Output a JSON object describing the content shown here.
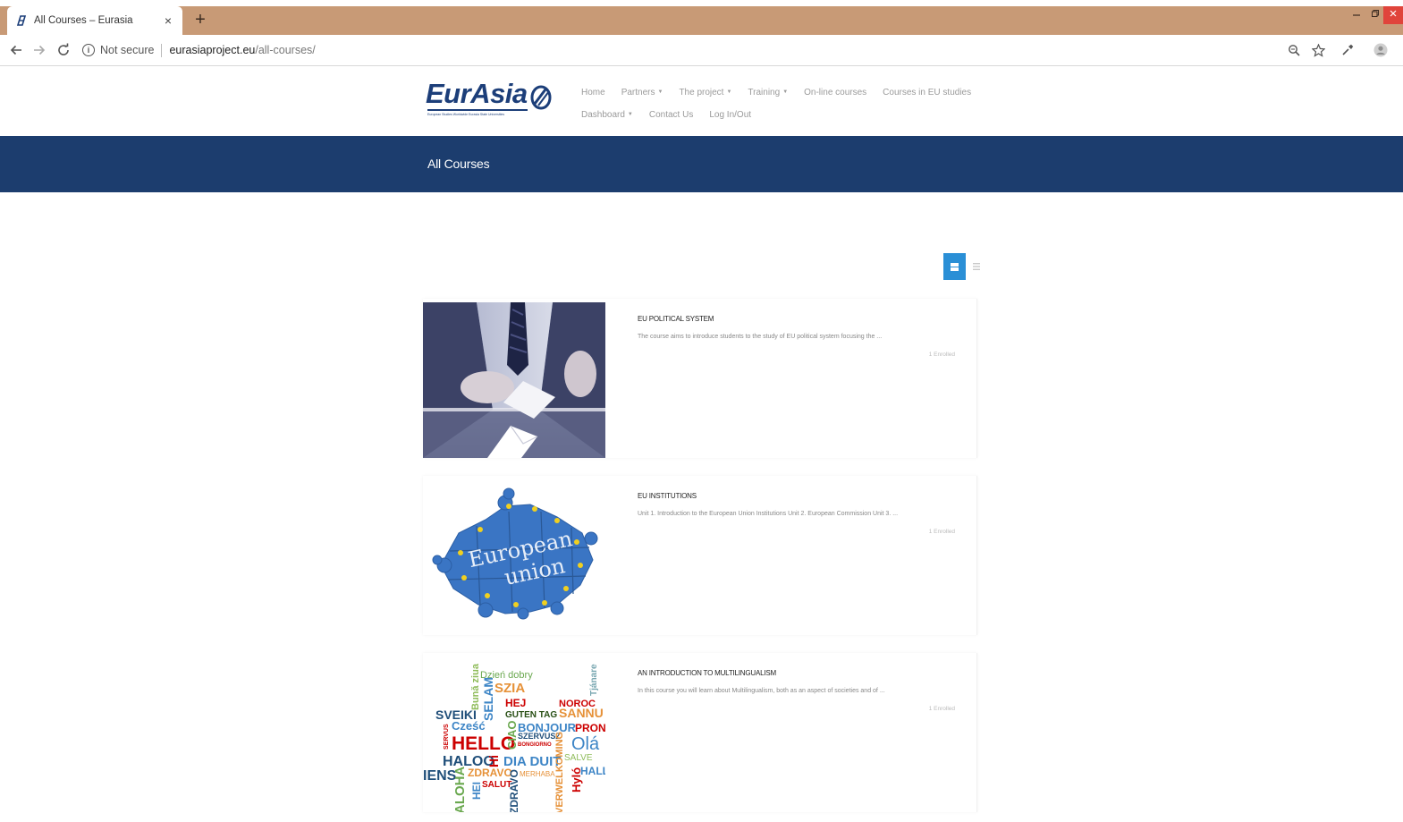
{
  "browser": {
    "tab_title": "All Courses – Eurasia",
    "tab_close": "×",
    "new_tab": "+",
    "not_secure": "Not secure",
    "url_host": "eurasiaproject.eu",
    "url_path": "/all-courses/"
  },
  "site": {
    "logo_text": "EurAsia",
    "logo_tagline": "European Studies Worldwide Eurasia State Universities",
    "menu_row1": [
      {
        "label": "Home",
        "caret": ""
      },
      {
        "label": "Partners",
        "caret": "▼"
      },
      {
        "label": "The project",
        "caret": "▼"
      },
      {
        "label": "Training",
        "caret": "▼"
      },
      {
        "label": "On-line courses",
        "caret": ""
      },
      {
        "label": "Courses in EU studies",
        "caret": ""
      }
    ],
    "menu_row2": [
      {
        "label": "Dashboard",
        "caret": "▼"
      },
      {
        "label": "Contact Us",
        "caret": ""
      },
      {
        "label": "Log In/Out",
        "caret": ""
      }
    ],
    "page_title": "All Courses"
  },
  "courses": [
    {
      "title": "EU POLITICAL SYSTEM",
      "description": "The course aims to introduce students to the study of EU political system focusing the ...",
      "badge": "1 Enrolled",
      "image": "ballot-box-photo"
    },
    {
      "title": "EU INSTITUTIONS",
      "description": "Unit 1. Introduction to the European Union Institutions Unit 2. European Commission Unit 3. ...",
      "badge": "1 Enrolled",
      "image": "european-union-puzzle",
      "image_text": [
        "European",
        "union"
      ]
    },
    {
      "title": "AN INTRODUCTION TO MULTILINGUALISM",
      "description": "In this course you will learn about Multilingualism, both as an aspect of societies and of ...",
      "badge": "1 Enrolled",
      "image": "hello-word-cloud",
      "words": [
        "Dzień dobry",
        "SZIA",
        "Bună ziua",
        "SELAM",
        "HEJ",
        "Tjánare",
        "SVEIKI",
        "GUTEN TAG",
        "NOROC",
        "SANNU",
        "Cześć",
        "BONJOUR",
        "PRONT",
        "HELLO",
        "SZERVUSZ",
        "Olá",
        "HALOO",
        "DIA DUIT",
        "Hi",
        "SALVE",
        "IENS",
        "ZDRAVO",
        "HALL",
        "ALOHA",
        "HEI",
        "SALUT",
        "ZDRAVO",
        "VERWELKOMING",
        "Hyló",
        "CIAO",
        "SERVUS",
        "MERHABA",
        "BONGIORNO"
      ]
    }
  ],
  "colors": {
    "tabstrip": "#c89a76",
    "brand_navy": "#1c3d6e",
    "view_toggle_active": "#2a8fd6"
  }
}
